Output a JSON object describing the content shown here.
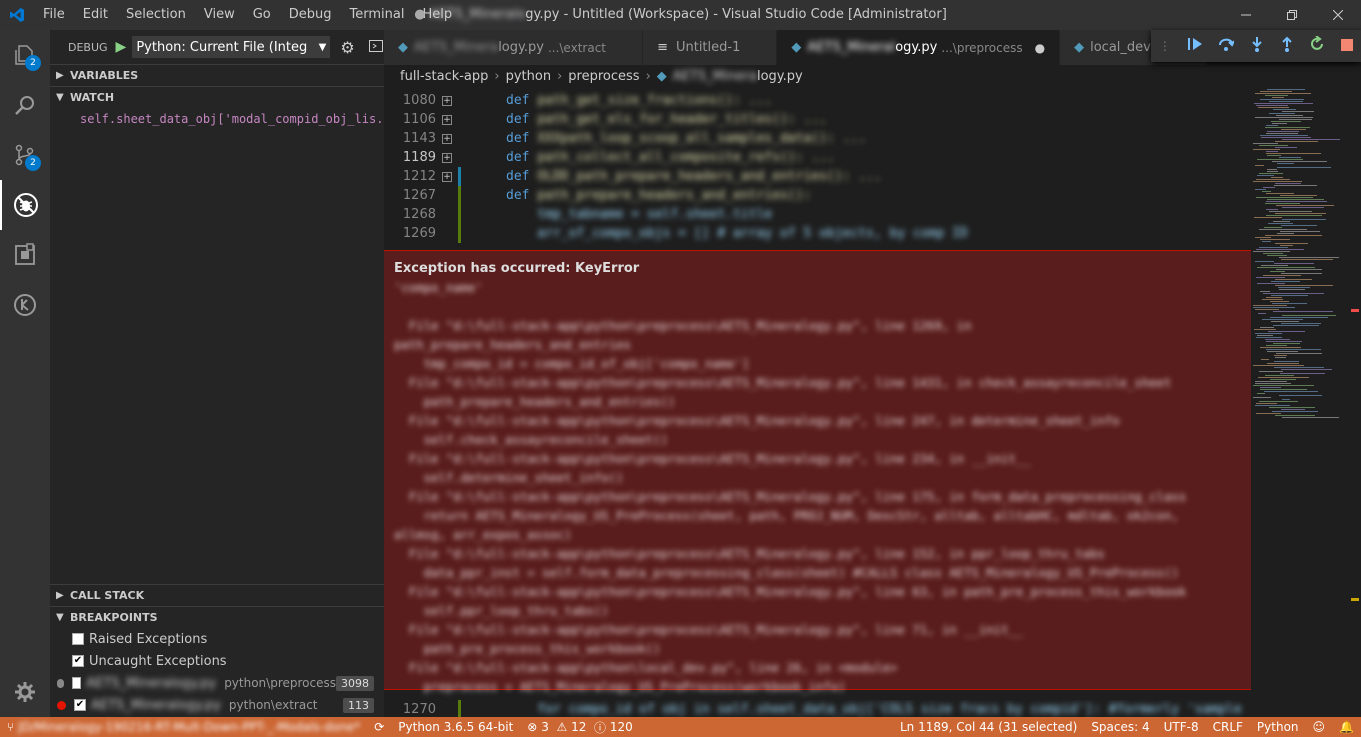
{
  "titlebar": {
    "menu": [
      "File",
      "Edit",
      "Selection",
      "View",
      "Go",
      "Debug",
      "Terminal",
      "Help"
    ],
    "title_prefix": "AETS_Mineralo",
    "title": "gy.py - Untitled (Workspace) - Visual Studio Code [Administrator]"
  },
  "activity": {
    "explorer_badge": "2",
    "scm_badge": "2"
  },
  "sidebar": {
    "debug_label": "DEBUG",
    "config": "Python: Current File (Integ",
    "variables": "VARIABLES",
    "watch": "WATCH",
    "watch_expr": "self.sheet_data_obj['modal_compid_obj_lis...",
    "call_stack": "CALL STACK",
    "breakpoints": "BREAKPOINTS",
    "bp_raised": "Raised Exceptions",
    "bp_uncaught": "Uncaught Exceptions",
    "bp_file1": "AETS_Mineralogy.py",
    "bp_path1": "python\\preprocess",
    "bp_count1": "3098",
    "bp_file2": "AETS_Mineralogy.py",
    "bp_path2": "python\\extract",
    "bp_count2": "113"
  },
  "tabs": [
    {
      "blur": "AETS_Minera",
      "name": "logy.py",
      "sub": "...\\extract"
    },
    {
      "blur": "",
      "name": "Untitled-1",
      "sub": ""
    },
    {
      "blur": "AETS_Mineral",
      "name": "ogy.py",
      "sub": "...\\preprocess"
    },
    {
      "blur": "",
      "name": "local_dev.py",
      "sub": ""
    }
  ],
  "breadcrumb": {
    "a": "full-stack-app",
    "b": "python",
    "c": "preprocess",
    "d_blur": "AETS_Minera",
    "d": "logy.py"
  },
  "code": {
    "kw_def": "def",
    "lines": [
      {
        "n": "1080",
        "t": "path_get_size_fractions(): ..."
      },
      {
        "n": "1106",
        "t": "path_get_els_for_header_titles(): ..."
      },
      {
        "n": "1143",
        "t": "XXXpath_loop_scoop_all_samples_data(): ..."
      },
      {
        "n": "1189",
        "t": "path_collect_all_composite_refs(): ..."
      },
      {
        "n": "1212",
        "t": "OLDD_path_prepare_headers_and_entries(): ..."
      },
      {
        "n": "1267",
        "t": "path_prepare_headers_and_entries():"
      },
      {
        "n": "1268",
        "t": "    tmp_tabname = self.sheet.title"
      },
      {
        "n": "1269",
        "t": "    arr_of_compo_objs = [] # array of 5 objects, by comp ID"
      }
    ],
    "bottom_n": "1270",
    "bottom_t": "    for compo_id of obj in self.sheet_data_obj['COLS size fracs by compid']: #formerly 'sample"
  },
  "exception": {
    "title": "Exception has occurred: KeyError",
    "trace": "'compo_name'\n\n  File \"d:\\full-stack-app\\python\\preprocess\\AETS_Mineralogy.py\", line 1269, in\npath_prepare_headers_and_entries\n    tmp_compo_id = compo_id_of_obj['compo_name']\n  File \"d:\\full-stack-app\\python\\preprocess\\AETS_Mineralogy.py\", line 1431, in check_assayreconcile_sheet\n    path_prepare_headers_and_entries()\n  File \"d:\\full-stack-app\\python\\preprocess\\AETS_Mineralogy.py\", line 247, in determine_sheet_info\n    self.check_assayreconcile_sheet()\n  File \"d:\\full-stack-app\\python\\preprocess\\AETS_Mineralogy.py\", line 234, in __init__\n    self.determine_sheet_info()\n  File \"d:\\full-stack-app\\python\\preprocess\\AETS_Mineralogy.py\", line 175, in form_data_preprocessing_class\n    return AETS_Mineralogy_US_PreProcess(sheet, path, PROJ_NUM, DescStr, alltab, alltabHC, mdltab, ok2con,\nallmsg, arr_expos_assoc)\n  File \"d:\\full-stack-app\\python\\preprocess\\AETS_Mineralogy.py\", line 152, in ppr_loop_thru_tabs\n    data_ppr_inst = self.form_data_preprocessing_class(sheet) #CALLS class AETS_Mineralogy_US_PreProcess()\n  File \"d:\\full-stack-app\\python\\preprocess\\AETS_Mineralogy.py\", line 63, in path_pre_process_this_workbook\n    self.ppr_loop_thru_tabs()\n  File \"d:\\full-stack-app\\python\\preprocess\\AETS_Mineralogy.py\", line 71, in __init__\n    path_pre_process_this_workbook()\n  File \"d:\\full-stack-app\\python\\local_dev.py\", line 26, in <module>\n    preprocess = AETS_Mineralogy_US_PreProcess(workbook_info)"
  },
  "statusbar": {
    "branch": "JD/Mineralogy-190216-RT-Mult-Down-PPT-_-Modals-done*",
    "python": "Python 3.6.5 64-bit",
    "errors": "3",
    "warnings": "12",
    "info": "120",
    "position": "Ln 1189, Col 44 (31 selected)",
    "spaces": "Spaces: 4",
    "encoding": "UTF-8",
    "eol": "CRLF",
    "language": "Python"
  }
}
